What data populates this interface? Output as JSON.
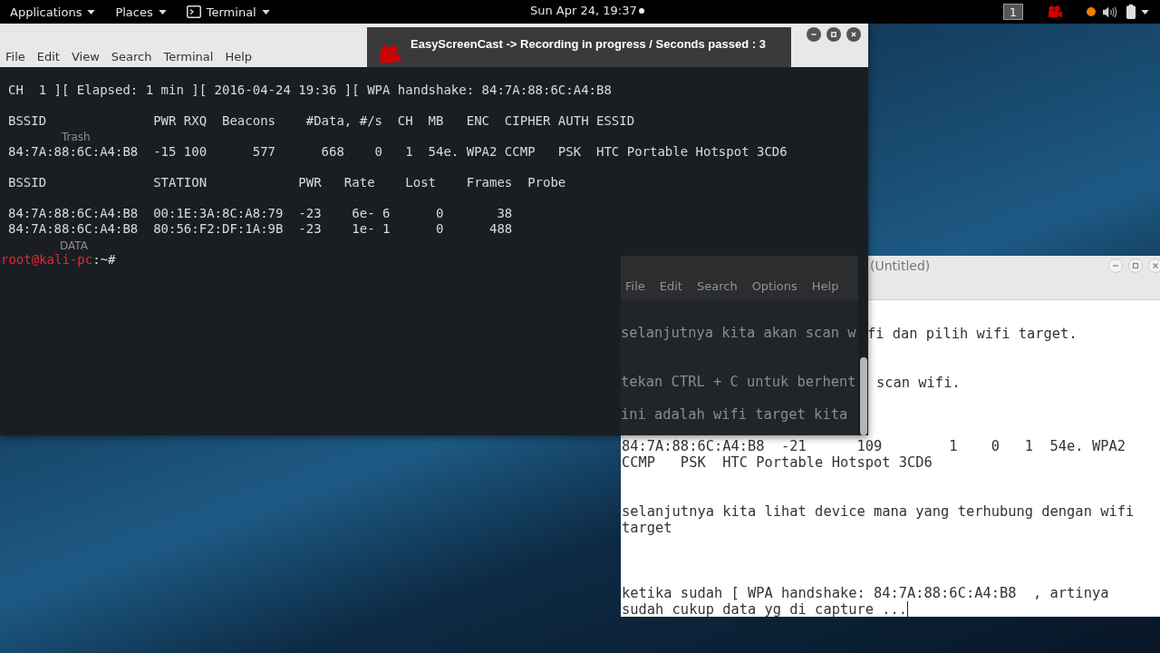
{
  "top_bar": {
    "menus": [
      {
        "label": "Applications",
        "kind": "menu"
      },
      {
        "label": "Places",
        "kind": "menu"
      },
      {
        "label": "Terminal",
        "kind": "app"
      }
    ],
    "clock": "Sun Apr 24, 19:37",
    "workspace": "1"
  },
  "desktop_icons": [
    {
      "label": "Trash"
    },
    {
      "label": "DATA"
    }
  ],
  "terminal": {
    "menu": [
      "File",
      "Edit",
      "View",
      "Search",
      "Terminal",
      "Help"
    ],
    "output_blocks": [
      [
        "CH  1 ][ Elapsed: 1 min ][ 2016-04-24 19:36 ][ WPA handshake: 84:7A:88:6C:A4:B8"
      ],
      [
        "BSSID              PWR RXQ  Beacons    #Data, #/s  CH  MB   ENC  CIPHER AUTH ESSID"
      ],
      [
        "84:7A:88:6C:A4:B8  -15 100      577      668    0   1  54e. WPA2 CCMP   PSK  HTC Portable Hotspot 3CD6"
      ],
      [
        "BSSID              STATION            PWR   Rate    Lost    Frames  Probe"
      ],
      [
        "84:7A:88:6C:A4:B8  00:1E:3A:8C:A8:79  -23    6e- 6      0       38",
        "84:7A:88:6C:A4:B8  80:56:F2:DF:1A:9B  -23    1e- 1      0      488"
      ]
    ],
    "prompt": {
      "user_host": "root@kali-pc",
      "suffix": ":~#"
    }
  },
  "notification": {
    "text": "EasyScreenCast -> Recording in progress / Seconds passed : 3"
  },
  "editor": {
    "title": "(Untitled)",
    "menu": [
      "File",
      "Edit",
      "Search",
      "Options",
      "Help"
    ],
    "lines_behind_terminal": [
      "selanjutnya kita akan scan w",
      "tekan CTRL + C untuk berhent",
      "ini adalah wifi target kita"
    ],
    "line_ends": [
      "fi dan pilih wifi target.",
      "scan wifi."
    ],
    "text": "84:7A:88:6C:A4:B8  -21      109        1    0   1  54e. WPA2 CCMP   PSK  HTC Portable Hotspot 3CD6\n\n\nselanjutnya kita lihat device mana yang terhubung dengan wifi target\n\n\n\nketika sudah [ WPA handshake: 84:7A:88:6C:A4:B8  , artinya sudah cukup data yg di capture ..."
  }
}
